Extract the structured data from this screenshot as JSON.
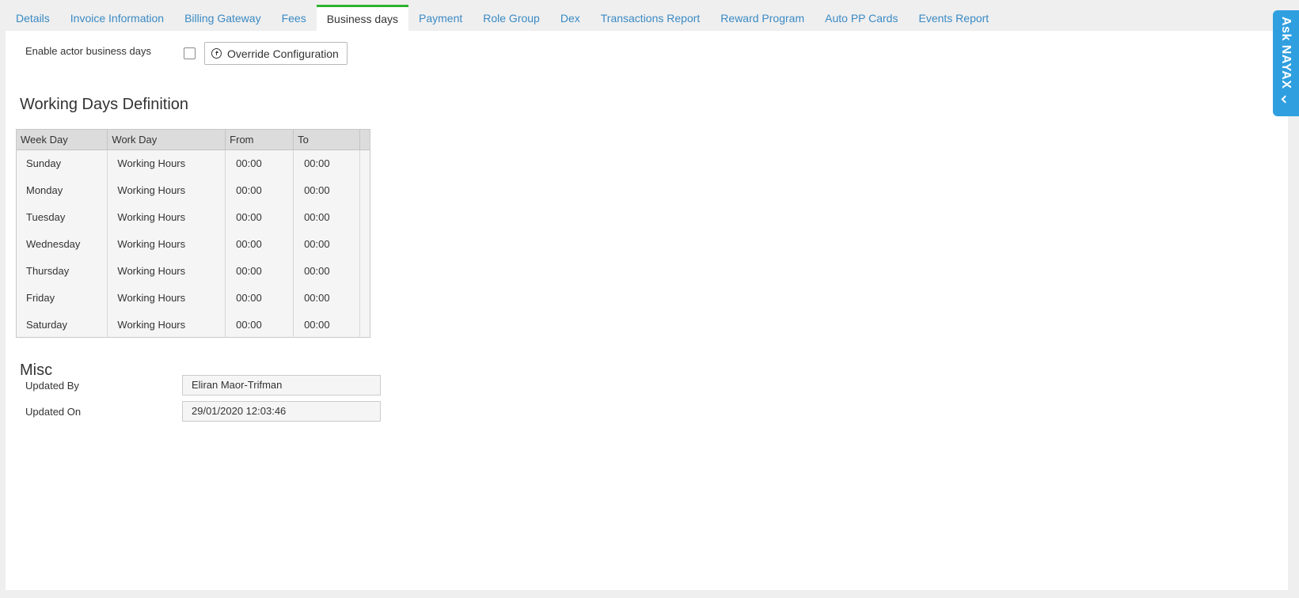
{
  "tabs": [
    {
      "label": "Details"
    },
    {
      "label": "Invoice Information"
    },
    {
      "label": "Billing Gateway"
    },
    {
      "label": "Fees"
    },
    {
      "label": "Business days",
      "active": true
    },
    {
      "label": "Payment"
    },
    {
      "label": "Role Group"
    },
    {
      "label": "Dex"
    },
    {
      "label": "Transactions Report"
    },
    {
      "label": "Reward Program"
    },
    {
      "label": "Auto PP Cards"
    },
    {
      "label": "Events Report"
    }
  ],
  "enable": {
    "label": "Enable actor business days",
    "checked": false,
    "override_button": "Override Configuration",
    "override_icon": "upload-circle-icon"
  },
  "working_days": {
    "title": "Working Days Definition",
    "columns": [
      "Week Day",
      "Work Day",
      "From",
      "To"
    ],
    "rows": [
      {
        "day": "Sunday",
        "work_day": "Working Hours",
        "from": "00:00",
        "to": "00:00"
      },
      {
        "day": "Monday",
        "work_day": "Working Hours",
        "from": "00:00",
        "to": "00:00"
      },
      {
        "day": "Tuesday",
        "work_day": "Working Hours",
        "from": "00:00",
        "to": "00:00"
      },
      {
        "day": "Wednesday",
        "work_day": "Working Hours",
        "from": "00:00",
        "to": "00:00"
      },
      {
        "day": "Thursday",
        "work_day": "Working Hours",
        "from": "00:00",
        "to": "00:00"
      },
      {
        "day": "Friday",
        "work_day": "Working Hours",
        "from": "00:00",
        "to": "00:00"
      },
      {
        "day": "Saturday",
        "work_day": "Working Hours",
        "from": "00:00",
        "to": "00:00"
      }
    ]
  },
  "misc": {
    "title": "Misc",
    "updated_by_label": "Updated By",
    "updated_by_value": "Eliran Maor-Trifman",
    "updated_on_label": "Updated On",
    "updated_on_value": "29/01/2020 12:03:46"
  },
  "ask_panel": {
    "label": "Ask NAYAX",
    "icon": "chevron-left-icon",
    "color": "#2f9fe0"
  },
  "colors": {
    "active_tab_accent": "#2db32d",
    "tab_link": "#3a8ac4"
  }
}
